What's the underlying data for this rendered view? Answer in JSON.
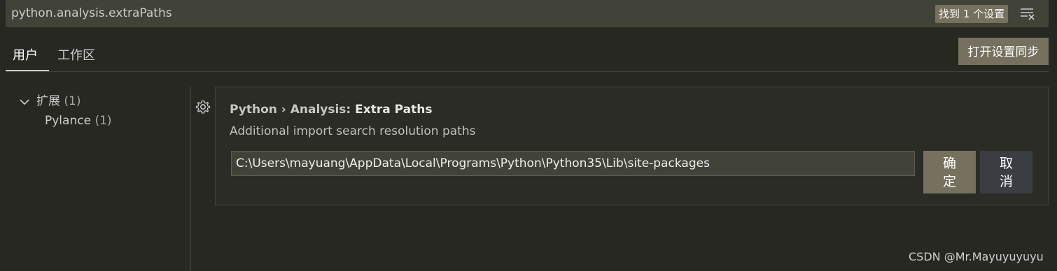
{
  "search": {
    "query": "python.analysis.extraPaths",
    "results_label": "找到 1 个设置",
    "filter_icon": "clear-filter-icon"
  },
  "tabs": [
    {
      "label": "用户",
      "active": true
    },
    {
      "label": "工作区",
      "active": false
    }
  ],
  "sync_button": {
    "label": "打开设置同步"
  },
  "toc": {
    "extensions": {
      "label": "扩展",
      "count": "(1)",
      "icon": "chevron-down-icon"
    },
    "pylance": {
      "label": "Pylance",
      "count": "(1)"
    }
  },
  "setting": {
    "gear_icon": "gear-icon",
    "category": "Python › Analysis: ",
    "name": "Extra Paths",
    "description": "Additional import search resolution paths",
    "value": "C:\\Users\\mayuang\\AppData\\Local\\Programs\\Python\\Python35\\Lib\\site-packages",
    "ok_label_line1": "确",
    "ok_label_line2": "定",
    "cancel_label_line1": "取",
    "cancel_label_line2": "消"
  },
  "watermark": "CSDN @Mr.Mayuyuyuyu",
  "colors": {
    "background": "#272822",
    "search_bg": "#414339",
    "accent_button": "#75715e",
    "cancel_button": "#3a3d41"
  }
}
